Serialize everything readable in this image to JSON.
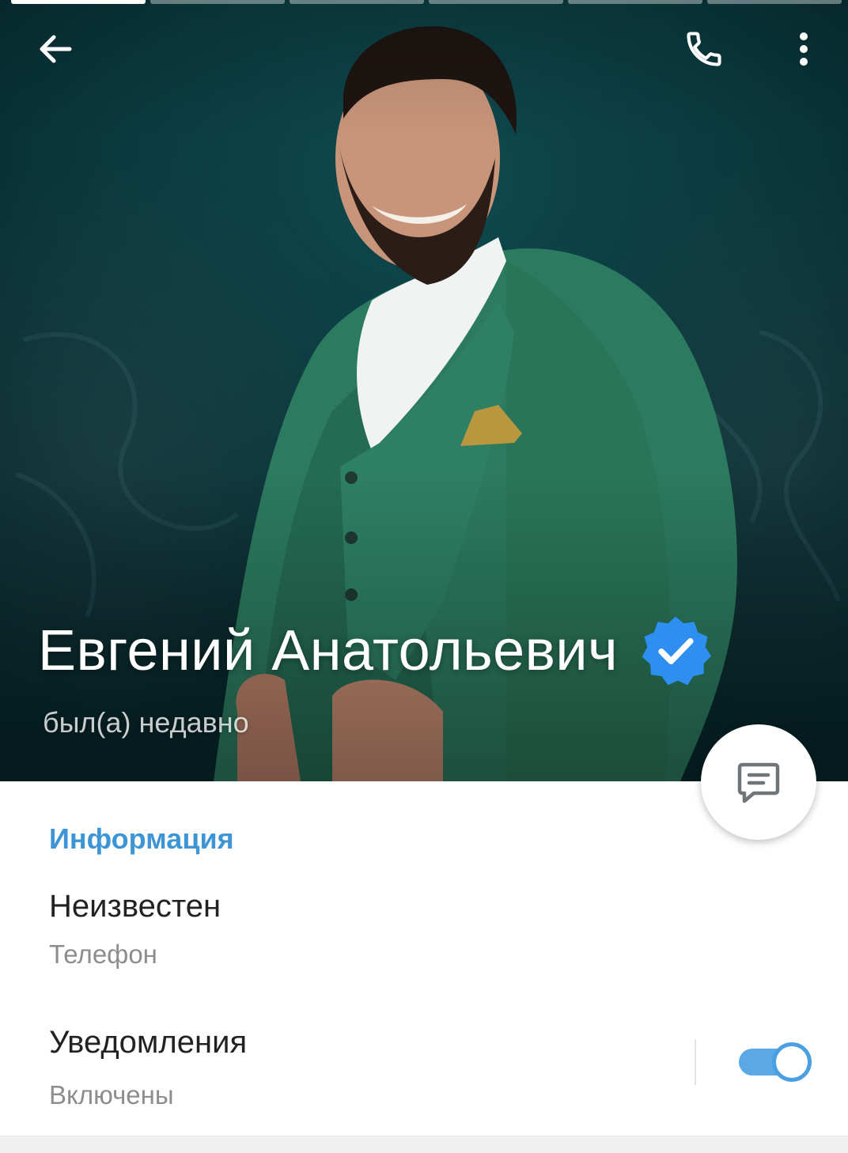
{
  "header": {
    "segments": [
      {
        "active": true
      },
      {
        "active": false
      },
      {
        "active": false
      },
      {
        "active": false
      },
      {
        "active": false
      },
      {
        "active": false
      }
    ],
    "back_icon": "arrow-left-icon",
    "call_icon": "phone-icon",
    "menu_icon": "more-vertical-icon"
  },
  "profile": {
    "name": "Евгений Анатольевич",
    "verified": true,
    "verified_icon": "verified-badge-icon",
    "status": "был(а) недавно"
  },
  "fab": {
    "icon": "message-icon"
  },
  "info": {
    "section_title": "Информация",
    "phone": {
      "value": "Неизвестен",
      "label": "Телефон"
    },
    "notifications": {
      "value": "Уведомления",
      "label": "Включены",
      "enabled": true
    }
  },
  "colors": {
    "accent": "#3d95d6",
    "toggle": "#5aa8e6",
    "verified": "#2f8ff0",
    "hero_bg": "#0a3a3f"
  }
}
